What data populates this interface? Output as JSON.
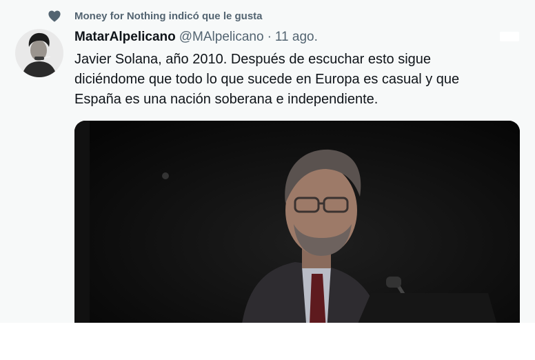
{
  "social_context": {
    "icon": "heart-icon",
    "text": "Money for Nothing indicó que le gusta"
  },
  "author": {
    "name": "MatarAlpelicano",
    "handle": "@MAlpelicano",
    "separator": "·",
    "timestamp": "11 ago."
  },
  "tweet": {
    "lines": [
      "Javier Solana, año 2010. Después de escuchar esto sigue",
      "diciéndome que todo lo que sucede en Europa es casual y que",
      "España es una nación soberana e independiente."
    ]
  },
  "colors": {
    "background": "#f7f9f9",
    "primary_text": "#0f1419",
    "secondary_text": "#536471"
  }
}
